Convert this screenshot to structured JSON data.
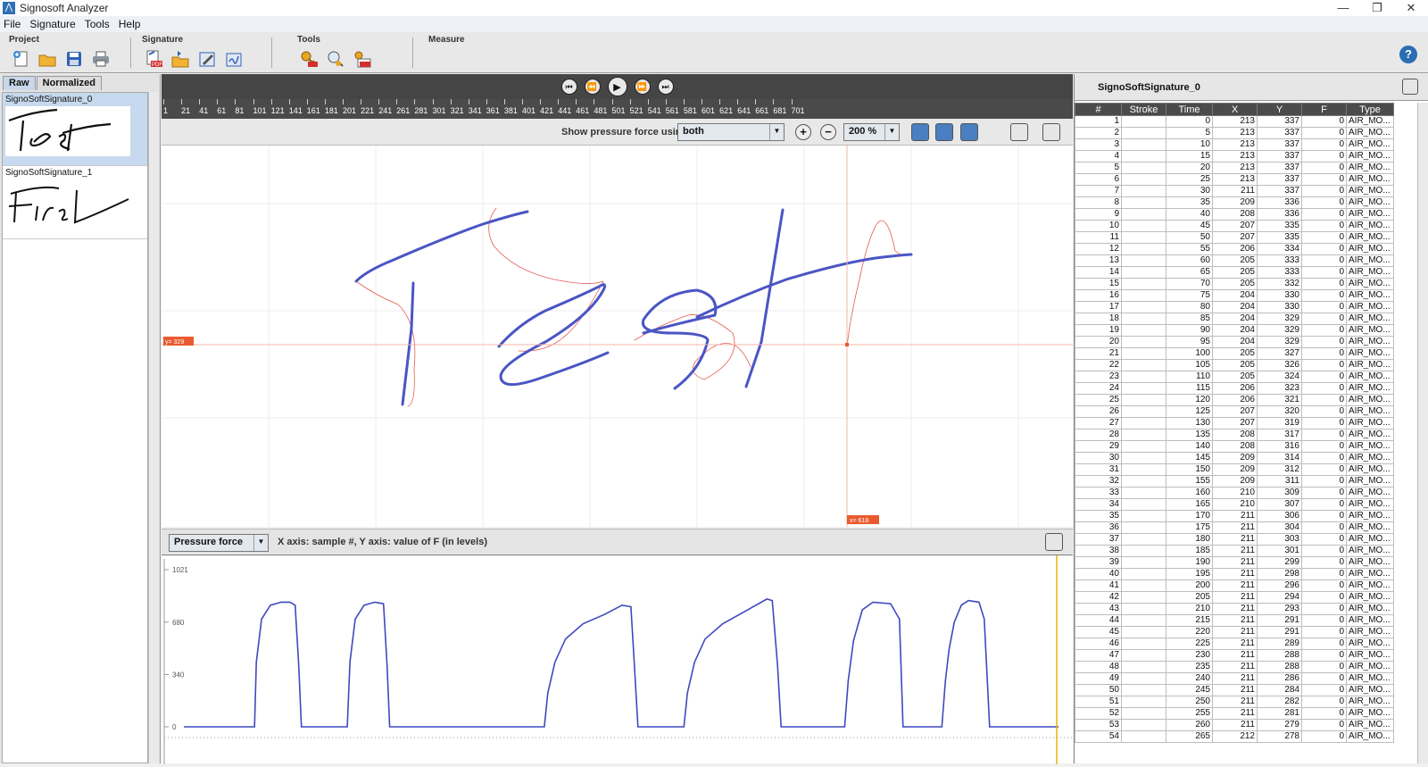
{
  "window": {
    "title": "Signosoft Analyzer",
    "controls": [
      "—",
      "❐",
      "✕"
    ]
  },
  "menu": [
    "File",
    "Signature",
    "Tools",
    "Help"
  ],
  "toolbar": {
    "groups": [
      {
        "label": "Project",
        "icons": [
          "new-project-icon",
          "open-project-icon",
          "save-project-icon",
          "print-icon"
        ]
      },
      {
        "label": "Signature",
        "icons": [
          "export-pdf-icon",
          "import-signature-icon",
          "edit-signature-icon",
          "sign-signature-icon"
        ]
      },
      {
        "label": "Tools",
        "icons": [
          "key-tool-icon",
          "search-key-icon",
          "pdf-key-icon"
        ]
      },
      {
        "label": "Measure",
        "icons": []
      }
    ],
    "help": "?"
  },
  "left": {
    "tabs": [
      "Raw",
      "Normalized"
    ],
    "signatures": [
      {
        "name": "SignoSoftSignature_0",
        "selected": true
      },
      {
        "name": "SignoSoftSignature_1",
        "selected": false
      }
    ]
  },
  "ruler": {
    "ticks": [
      "1",
      "21",
      "41",
      "61",
      "81",
      "101",
      "121",
      "141",
      "161",
      "181",
      "201",
      "221",
      "241",
      "261",
      "281",
      "301",
      "321",
      "341",
      "361",
      "381",
      "401",
      "421",
      "441",
      "461",
      "481",
      "501",
      "521",
      "541",
      "561",
      "581",
      "601",
      "621",
      "641",
      "661",
      "681",
      "701"
    ]
  },
  "options": {
    "pressure_label": "Show pressure force using",
    "pressure_value": "both",
    "zoom": "200 %"
  },
  "canvas": {
    "cursor_y_label": "y= 329",
    "cursor_x_label": "x= 618",
    "accent": "#4a55c4",
    "air_color": "#e35b52"
  },
  "pressure": {
    "select": "Pressure force",
    "axis_description": "X axis: sample #, Y axis: value of F (in levels)"
  },
  "chart_data": {
    "type": "line",
    "title": "",
    "ylabel": "",
    "xlabel": "",
    "ylim": [
      0,
      1021
    ],
    "yticks": [
      0,
      340,
      680,
      1021
    ],
    "series": [
      {
        "points": [
          [
            0,
            0
          ],
          [
            80,
            0
          ],
          [
            82,
            420
          ],
          [
            88,
            700
          ],
          [
            98,
            790
          ],
          [
            110,
            810
          ],
          [
            120,
            810
          ],
          [
            126,
            790
          ],
          [
            130,
            400
          ],
          [
            133,
            0
          ],
          [
            185,
            0
          ],
          [
            188,
            420
          ],
          [
            194,
            700
          ],
          [
            204,
            790
          ],
          [
            216,
            810
          ],
          [
            226,
            800
          ],
          [
            230,
            400
          ],
          [
            233,
            0
          ],
          [
            408,
            0
          ],
          [
            412,
            220
          ],
          [
            420,
            420
          ],
          [
            432,
            570
          ],
          [
            452,
            670
          ],
          [
            476,
            730
          ],
          [
            496,
            790
          ],
          [
            506,
            780
          ],
          [
            510,
            400
          ],
          [
            514,
            0
          ],
          [
            566,
            0
          ],
          [
            570,
            220
          ],
          [
            578,
            420
          ],
          [
            590,
            570
          ],
          [
            610,
            670
          ],
          [
            632,
            740
          ],
          [
            660,
            830
          ],
          [
            666,
            820
          ],
          [
            672,
            400
          ],
          [
            676,
            0
          ],
          [
            748,
            0
          ],
          [
            752,
            300
          ],
          [
            758,
            560
          ],
          [
            768,
            760
          ],
          [
            780,
            810
          ],
          [
            800,
            800
          ],
          [
            810,
            700
          ],
          [
            814,
            0
          ],
          [
            858,
            0
          ],
          [
            862,
            300
          ],
          [
            866,
            500
          ],
          [
            872,
            680
          ],
          [
            880,
            790
          ],
          [
            888,
            820
          ],
          [
            900,
            810
          ],
          [
            906,
            700
          ],
          [
            912,
            0
          ],
          [
            990,
            0
          ]
        ]
      }
    ]
  },
  "table": {
    "title": "SignoSoftSignature_0",
    "columns": [
      "#",
      "Stroke",
      "Time",
      "X",
      "Y",
      "F",
      "Type"
    ],
    "rows": [
      [
        "1",
        "",
        "0",
        "213",
        "337",
        "0",
        "AIR_MO..."
      ],
      [
        "2",
        "",
        "5",
        "213",
        "337",
        "0",
        "AIR_MO..."
      ],
      [
        "3",
        "",
        "10",
        "213",
        "337",
        "0",
        "AIR_MO..."
      ],
      [
        "4",
        "",
        "15",
        "213",
        "337",
        "0",
        "AIR_MO..."
      ],
      [
        "5",
        "",
        "20",
        "213",
        "337",
        "0",
        "AIR_MO..."
      ],
      [
        "6",
        "",
        "25",
        "213",
        "337",
        "0",
        "AIR_MO..."
      ],
      [
        "7",
        "",
        "30",
        "211",
        "337",
        "0",
        "AIR_MO..."
      ],
      [
        "8",
        "",
        "35",
        "209",
        "336",
        "0",
        "AIR_MO..."
      ],
      [
        "9",
        "",
        "40",
        "208",
        "336",
        "0",
        "AIR_MO..."
      ],
      [
        "10",
        "",
        "45",
        "207",
        "335",
        "0",
        "AIR_MO..."
      ],
      [
        "11",
        "",
        "50",
        "207",
        "335",
        "0",
        "AIR_MO..."
      ],
      [
        "12",
        "",
        "55",
        "206",
        "334",
        "0",
        "AIR_MO..."
      ],
      [
        "13",
        "",
        "60",
        "205",
        "333",
        "0",
        "AIR_MO..."
      ],
      [
        "14",
        "",
        "65",
        "205",
        "333",
        "0",
        "AIR_MO..."
      ],
      [
        "15",
        "",
        "70",
        "205",
        "332",
        "0",
        "AIR_MO..."
      ],
      [
        "16",
        "",
        "75",
        "204",
        "330",
        "0",
        "AIR_MO..."
      ],
      [
        "17",
        "",
        "80",
        "204",
        "330",
        "0",
        "AIR_MO..."
      ],
      [
        "18",
        "",
        "85",
        "204",
        "329",
        "0",
        "AIR_MO..."
      ],
      [
        "19",
        "",
        "90",
        "204",
        "329",
        "0",
        "AIR_MO..."
      ],
      [
        "20",
        "",
        "95",
        "204",
        "329",
        "0",
        "AIR_MO..."
      ],
      [
        "21",
        "",
        "100",
        "205",
        "327",
        "0",
        "AIR_MO..."
      ],
      [
        "22",
        "",
        "105",
        "205",
        "326",
        "0",
        "AIR_MO..."
      ],
      [
        "23",
        "",
        "110",
        "205",
        "324",
        "0",
        "AIR_MO..."
      ],
      [
        "24",
        "",
        "115",
        "206",
        "323",
        "0",
        "AIR_MO..."
      ],
      [
        "25",
        "",
        "120",
        "206",
        "321",
        "0",
        "AIR_MO..."
      ],
      [
        "26",
        "",
        "125",
        "207",
        "320",
        "0",
        "AIR_MO..."
      ],
      [
        "27",
        "",
        "130",
        "207",
        "319",
        "0",
        "AIR_MO..."
      ],
      [
        "28",
        "",
        "135",
        "208",
        "317",
        "0",
        "AIR_MO..."
      ],
      [
        "29",
        "",
        "140",
        "208",
        "316",
        "0",
        "AIR_MO..."
      ],
      [
        "30",
        "",
        "145",
        "209",
        "314",
        "0",
        "AIR_MO..."
      ],
      [
        "31",
        "",
        "150",
        "209",
        "312",
        "0",
        "AIR_MO..."
      ],
      [
        "32",
        "",
        "155",
        "209",
        "311",
        "0",
        "AIR_MO..."
      ],
      [
        "33",
        "",
        "160",
        "210",
        "309",
        "0",
        "AIR_MO..."
      ],
      [
        "34",
        "",
        "165",
        "210",
        "307",
        "0",
        "AIR_MO..."
      ],
      [
        "35",
        "",
        "170",
        "211",
        "306",
        "0",
        "AIR_MO..."
      ],
      [
        "36",
        "",
        "175",
        "211",
        "304",
        "0",
        "AIR_MO..."
      ],
      [
        "37",
        "",
        "180",
        "211",
        "303",
        "0",
        "AIR_MO..."
      ],
      [
        "38",
        "",
        "185",
        "211",
        "301",
        "0",
        "AIR_MO..."
      ],
      [
        "39",
        "",
        "190",
        "211",
        "299",
        "0",
        "AIR_MO..."
      ],
      [
        "40",
        "",
        "195",
        "211",
        "298",
        "0",
        "AIR_MO..."
      ],
      [
        "41",
        "",
        "200",
        "211",
        "296",
        "0",
        "AIR_MO..."
      ],
      [
        "42",
        "",
        "205",
        "211",
        "294",
        "0",
        "AIR_MO..."
      ],
      [
        "43",
        "",
        "210",
        "211",
        "293",
        "0",
        "AIR_MO..."
      ],
      [
        "44",
        "",
        "215",
        "211",
        "291",
        "0",
        "AIR_MO..."
      ],
      [
        "45",
        "",
        "220",
        "211",
        "291",
        "0",
        "AIR_MO..."
      ],
      [
        "46",
        "",
        "225",
        "211",
        "289",
        "0",
        "AIR_MO..."
      ],
      [
        "47",
        "",
        "230",
        "211",
        "288",
        "0",
        "AIR_MO..."
      ],
      [
        "48",
        "",
        "235",
        "211",
        "288",
        "0",
        "AIR_MO..."
      ],
      [
        "49",
        "",
        "240",
        "211",
        "286",
        "0",
        "AIR_MO..."
      ],
      [
        "50",
        "",
        "245",
        "211",
        "284",
        "0",
        "AIR_MO..."
      ],
      [
        "51",
        "",
        "250",
        "211",
        "282",
        "0",
        "AIR_MO..."
      ],
      [
        "52",
        "",
        "255",
        "211",
        "281",
        "0",
        "AIR_MO..."
      ],
      [
        "53",
        "",
        "260",
        "211",
        "279",
        "0",
        "AIR_MO..."
      ],
      [
        "54",
        "",
        "265",
        "212",
        "278",
        "0",
        "AIR_MO..."
      ]
    ]
  }
}
